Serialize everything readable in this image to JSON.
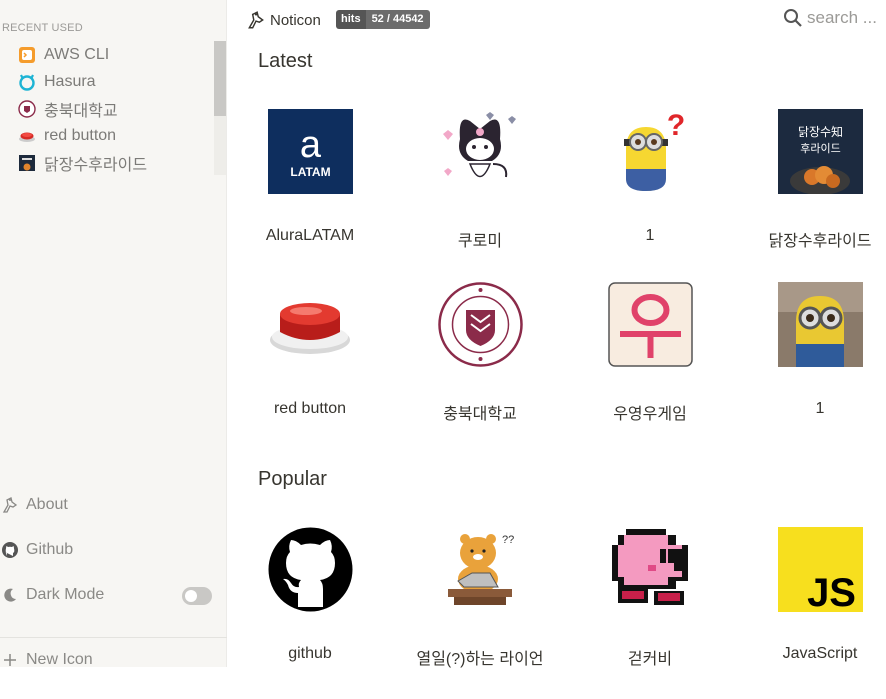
{
  "sidebar": {
    "recent_title": "RECENT USED",
    "recent": [
      {
        "label": "AWS CLI",
        "icon": "aws-cli-icon"
      },
      {
        "label": "Hasura",
        "icon": "hasura-icon"
      },
      {
        "label": "충북대학교",
        "icon": "chungbuk-univ-icon"
      },
      {
        "label": "red button",
        "icon": "red-button-icon"
      },
      {
        "label": "닭장수후라이드",
        "icon": "chicken-icon"
      }
    ],
    "about": "About",
    "github": "Github",
    "dark_mode": "Dark Mode",
    "dark_mode_on": false,
    "new_icon": "New Icon"
  },
  "header": {
    "brand": "Noticon",
    "hits_label": "hits",
    "hits_value": "52 / 44542",
    "search_placeholder": "search ..."
  },
  "latest": {
    "title": "Latest",
    "items": [
      {
        "label": "AluraLATAM",
        "icon": "alura-latam-icon"
      },
      {
        "label": "쿠로미",
        "icon": "kuromi-icon"
      },
      {
        "label": "1",
        "icon": "minion-question-icon"
      },
      {
        "label": "닭장수후라이드",
        "icon": "chicken-icon"
      },
      {
        "label": "red button",
        "icon": "red-button-icon"
      },
      {
        "label": "충북대학교",
        "icon": "chungbuk-univ-icon"
      },
      {
        "label": "우영우게임",
        "icon": "woo-game-icon"
      },
      {
        "label": "1",
        "icon": "minion-photo-icon"
      }
    ]
  },
  "popular": {
    "title": "Popular",
    "items": [
      {
        "label": "github",
        "icon": "github-icon"
      },
      {
        "label": "열일(?)하는 라이언",
        "icon": "ryan-working-icon"
      },
      {
        "label": "걷커비",
        "icon": "kirby-icon"
      },
      {
        "label": "JavaScript",
        "icon": "javascript-icon"
      }
    ]
  }
}
